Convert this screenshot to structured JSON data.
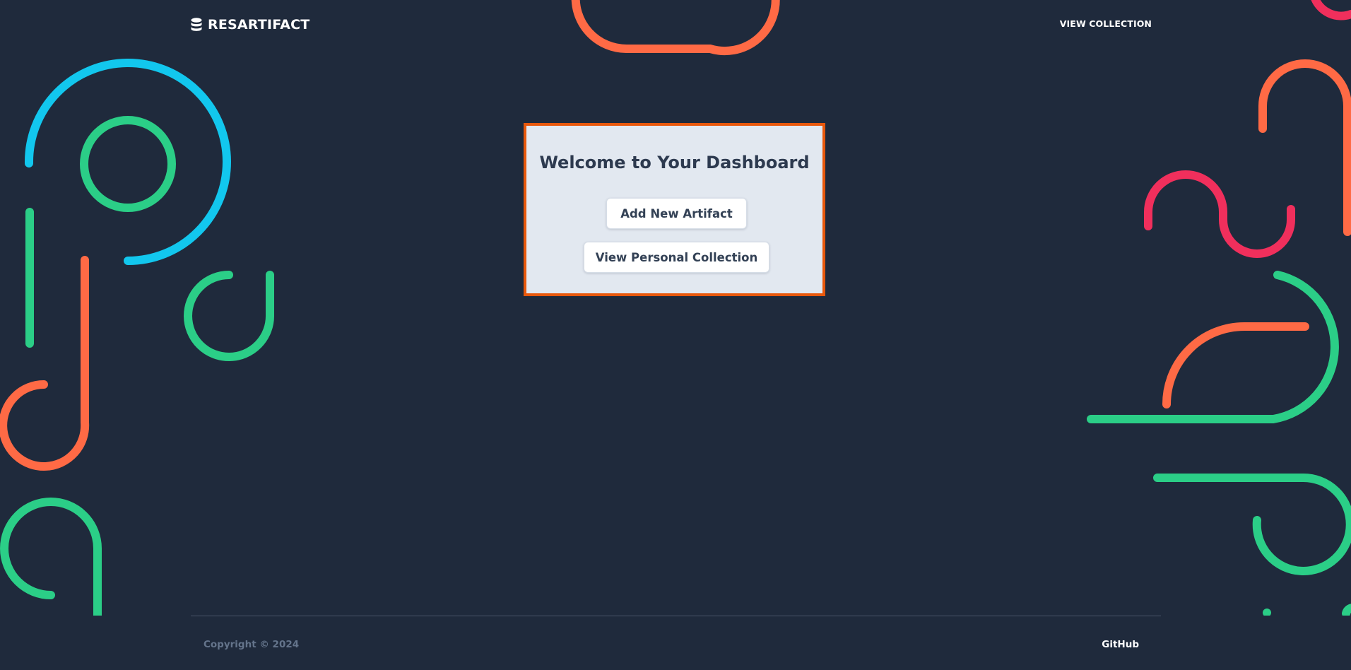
{
  "header": {
    "brand_name": "RESARTIFACT",
    "brand_icon": "database-icon",
    "nav_view_collection": "VIEW COLLECTION"
  },
  "main": {
    "title": "Welcome to Your Dashboard",
    "add_button_label": "Add New Artifact",
    "view_button_label": "View Personal Collection"
  },
  "footer": {
    "copyright": "Copyright © 2024",
    "github_label": "GitHub"
  },
  "colors": {
    "background": "#1f2a3c",
    "card_background": "#e2e8f0",
    "card_border": "#e8580c",
    "accent_orange": "#ff6a45",
    "accent_green": "#2bce87",
    "accent_cyan": "#12c7ee",
    "accent_pink": "#f02f5c"
  }
}
